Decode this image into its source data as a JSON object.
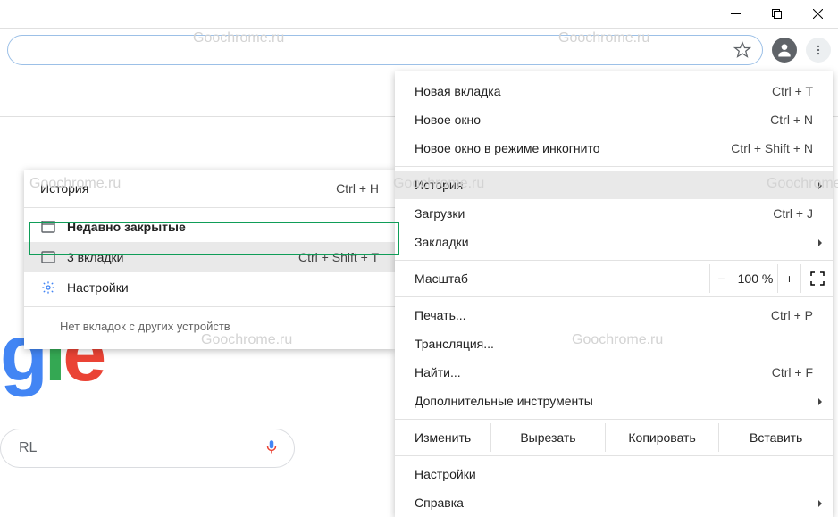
{
  "watermark": "Goochrome.ru",
  "window_controls": {
    "minimize": "minimize",
    "maximize": "maximize",
    "close": "close"
  },
  "main_menu": {
    "items": [
      {
        "label": "Новая вкладка",
        "shortcut": "Ctrl + T"
      },
      {
        "label": "Новое окно",
        "shortcut": "Ctrl + N"
      },
      {
        "label": "Новое окно в режиме инкогнито",
        "shortcut": "Ctrl + Shift + N"
      }
    ],
    "history": {
      "label": "История"
    },
    "downloads": {
      "label": "Загрузки",
      "shortcut": "Ctrl + J"
    },
    "bookmarks": {
      "label": "Закладки"
    },
    "zoom": {
      "label": "Масштаб",
      "minus": "−",
      "value": "100 %",
      "plus": "+"
    },
    "print": {
      "label": "Печать...",
      "shortcut": "Ctrl + P"
    },
    "cast": {
      "label": "Трансляция..."
    },
    "find": {
      "label": "Найти...",
      "shortcut": "Ctrl + F"
    },
    "more_tools": {
      "label": "Дополнительные инструменты"
    },
    "edit": {
      "label": "Изменить",
      "cut": "Вырезать",
      "copy": "Копировать",
      "paste": "Вставить"
    },
    "settings": {
      "label": "Настройки"
    },
    "help": {
      "label": "Справка"
    }
  },
  "history_menu": {
    "title": {
      "label": "История",
      "shortcut": "Ctrl + H"
    },
    "recent_section": "Недавно закрытые",
    "items": [
      {
        "label": "3 вкладки",
        "shortcut": "Ctrl + Shift + T"
      },
      {
        "label": "Настройки"
      }
    ],
    "empty": "Нет вкладок с других устройств"
  },
  "search_stub": {
    "placeholder": "RL"
  }
}
